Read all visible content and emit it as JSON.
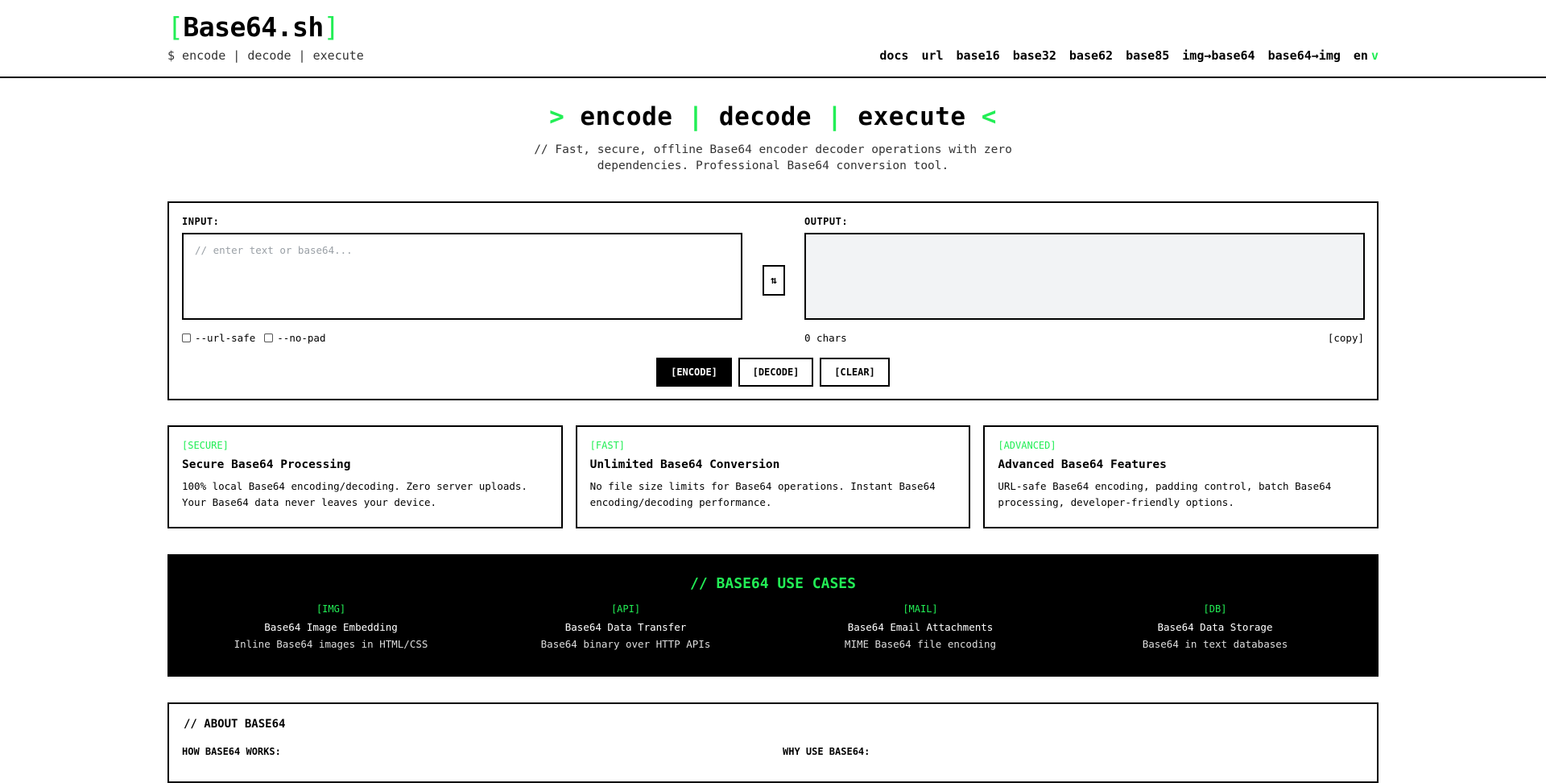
{
  "header": {
    "logo_open": "[",
    "logo_text": "Base64.sh",
    "logo_close": "]",
    "tagline": "$ encode | decode | execute",
    "nav": [
      "docs",
      "url",
      "base16",
      "base32",
      "base62",
      "base85",
      "img→base64",
      "base64→img"
    ],
    "lang": "en",
    "lang_arrow": "v"
  },
  "hero": {
    "prefix": ">",
    "w1": "encode",
    "sep": "|",
    "w2": "decode",
    "w3": "execute",
    "suffix": "<",
    "subtitle": "// Fast, secure, offline Base64 encoder decoder operations with zero dependencies. Professional Base64 conversion tool."
  },
  "tool": {
    "input_label": "INPUT:",
    "output_label": "OUTPUT:",
    "input_placeholder": "// enter text or base64...",
    "swap_icon": "⇅",
    "opt_url_safe": "--url-safe",
    "opt_no_pad": "--no-pad",
    "chars": "0 chars",
    "copy": "[copy]",
    "encode": "[ENCODE]",
    "decode": "[DECODE]",
    "clear": "[CLEAR]"
  },
  "features": [
    {
      "tag": "[SECURE]",
      "title": "Secure Base64 Processing",
      "desc": "100% local Base64 encoding/decoding. Zero server uploads. Your Base64 data never leaves your device."
    },
    {
      "tag": "[FAST]",
      "title": "Unlimited Base64 Conversion",
      "desc": "No file size limits for Base64 operations. Instant Base64 encoding/decoding performance."
    },
    {
      "tag": "[ADVANCED]",
      "title": "Advanced Base64 Features",
      "desc": "URL-safe Base64 encoding, padding control, batch Base64 processing, developer-friendly options."
    }
  ],
  "usecases": {
    "title": "// BASE64 USE CASES",
    "items": [
      {
        "tag": "[IMG]",
        "title": "Base64 Image Embedding",
        "desc": "Inline Base64 images in HTML/CSS"
      },
      {
        "tag": "[API]",
        "title": "Base64 Data Transfer",
        "desc": "Base64 binary over HTTP APIs"
      },
      {
        "tag": "[MAIL]",
        "title": "Base64 Email Attachments",
        "desc": "MIME Base64 file encoding"
      },
      {
        "tag": "[DB]",
        "title": "Base64 Data Storage",
        "desc": "Base64 in text databases"
      }
    ]
  },
  "about": {
    "title": "// ABOUT BASE64",
    "how": "HOW BASE64 WORKS:",
    "why": "WHY USE BASE64:"
  },
  "colors": {
    "accent": "#22ee55",
    "ink": "#000000",
    "output_bg": "#f2f3f5"
  }
}
